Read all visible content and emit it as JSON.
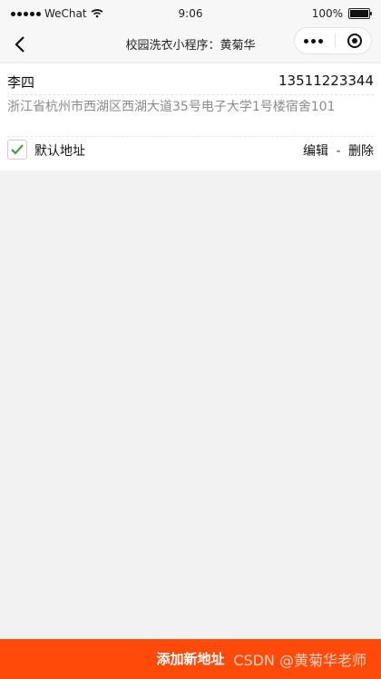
{
  "status_bar": {
    "carrier": "WeChat",
    "time": "9:06",
    "battery": "100%"
  },
  "nav": {
    "title": "校园洗衣小程序：黄菊华"
  },
  "address_card": {
    "name": "李四",
    "phone": "13511223344",
    "address": "浙江省杭州市西湖区西湖大道35号电子大学1号楼宿舍101",
    "default_label": "默认地址",
    "edit_label": "编辑",
    "separator": "-",
    "delete_label": "删除",
    "default_checked": true
  },
  "bottom": {
    "add_new_label": "添加新地址",
    "watermark": "CSDN @黄菊华老师"
  },
  "colors": {
    "accent": "#ff4a0a",
    "check": "#2ca02c"
  }
}
